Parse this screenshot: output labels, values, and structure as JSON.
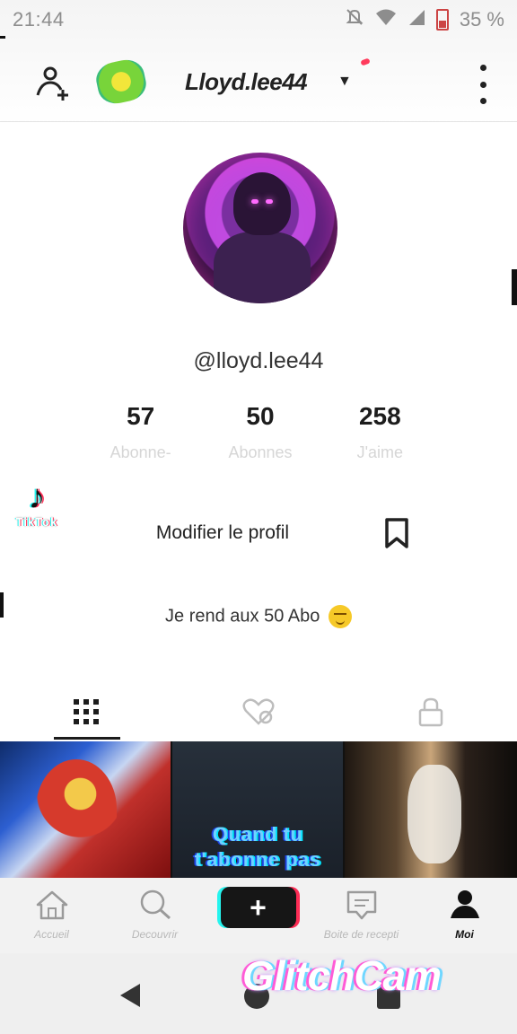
{
  "status_bar": {
    "time": "21:44",
    "battery": "35 %"
  },
  "top_nav": {
    "username": "Lloyd.lee44"
  },
  "profile": {
    "handle": "@lloyd.lee44",
    "stats": [
      {
        "value": "57",
        "label": "Abonne-"
      },
      {
        "value": "50",
        "label": "Abonnes"
      },
      {
        "value": "258",
        "label": "J'aime"
      }
    ],
    "edit_button": "Modifier le profil",
    "bio": "Je rend aux 50 Abo"
  },
  "watermark_tiktok": "TikTok",
  "videos": [
    {
      "caption": ""
    },
    {
      "caption_line1": "Quand tu",
      "caption_line2": "t'abonne pas"
    },
    {
      "caption": ""
    }
  ],
  "bottom_nav": [
    {
      "label": "Accueil",
      "icon": "home-icon"
    },
    {
      "label": "Decouvrir",
      "icon": "search-icon"
    },
    {
      "label": "",
      "icon": "plus-icon"
    },
    {
      "label": "Boite de recepti",
      "icon": "inbox-icon"
    },
    {
      "label": "Moi",
      "icon": "profile-icon"
    }
  ],
  "watermark_glitchcam": "GlitchCam",
  "colors": {
    "accent_cyan": "#25f4ee",
    "accent_pink": "#fe2c55"
  }
}
